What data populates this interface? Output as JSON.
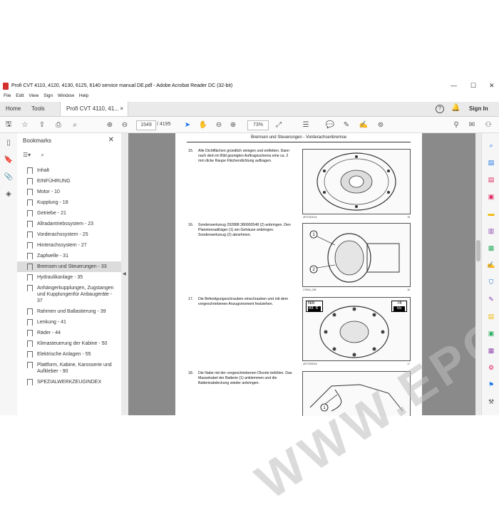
{
  "window": {
    "title": "Profi CVT 4110, 4120, 4130, 6125, 6140 service manual DE.pdf - Adobe Acrobat Reader DC (32-bit)",
    "minimize": "—",
    "maximize": "☐",
    "close": "✕"
  },
  "menu": [
    "File",
    "Edit",
    "View",
    "Sign",
    "Window",
    "Help"
  ],
  "tabs": {
    "home": "Home",
    "tools": "Tools",
    "doc": "Profi CVT 4110, 41...",
    "doc_close": "×",
    "help": "?",
    "sign_in": "Sign In"
  },
  "toolbar": {
    "page_current": "1549",
    "page_total": "/ 4195",
    "zoom": "73%"
  },
  "bookmarks": {
    "title": "Bookmarks",
    "items": [
      "Inhalt",
      "EINFÜHRUNG",
      "Motor - 10",
      "Kupplung - 18",
      "Getriebe - 21",
      "Allradantriebssystem - 23",
      "Vorderachssystem - 25",
      "Hinterachssystem - 27",
      "Zapfwelle - 31",
      "Bremsen und Steuerungen - 33",
      "Hydraulikanlage - 35",
      "Anhängerkupplungen, Zugstangen und Kupplungenfür Anbaugeräte - 37",
      "Rahmen und Ballastierung - 39",
      "Lenkung - 41",
      "Räder - 44",
      "Klimasteuerung der Kabine - 50",
      "Elektrische Anlagen - 55",
      "Plattform, Kabine, Karosserie und Aufkleber - 90",
      "SPEZIALWERKZEUGINDEX"
    ],
    "selected_index": 9
  },
  "document": {
    "header": "Bremsen und Steuerungen - Vorderachsenbremse",
    "watermark": "WWW.EPCDEPO.COM",
    "steps": [
      {
        "num": "15.",
        "text": "Alle Dichtflächen gründlich reinigen und entfetten. Dann nach dem im Bild gezeigten Auftragsschema eine ca. 2 mm dicke Raupe Flächendichtung auftragen.",
        "fig_ref": "ZEIT04001A",
        "fig_num": "15"
      },
      {
        "num": "16.",
        "text": "Sonderwerkzeug 292888 380000548 (2) anbringen. Den Planetenradträger (1) am Gehäuse anbringen. Sonderwerkzeug (2) abnehmen.",
        "fig_ref": "278M4_095",
        "fig_num": "16",
        "callouts": [
          "1",
          "2"
        ]
      },
      {
        "num": "17.",
        "text": "Die Befestigungsschrauben einschrauben und mit dem vorgeschriebenen Anzugsmoment festziehen.",
        "fig_ref": "ZEIT03903A",
        "fig_num": "17",
        "label_nm": "Nm",
        "label_lbft": "lbf. ft",
        "torque_nm": "74",
        "torque_lbft": "55"
      },
      {
        "num": "18.",
        "text": "Die Nabe mit der vorgeschriebenen Ölsorte befüllen. Das Massekabel der Batterie (1) anklemmen und die Batterieabdeckung wieder anbringen.",
        "callouts": [
          "1"
        ]
      }
    ]
  },
  "colors": {
    "accent_blue": "#1473e6",
    "pdf_red": "#d32f2f",
    "doc_bg": "#8a8a8a"
  }
}
